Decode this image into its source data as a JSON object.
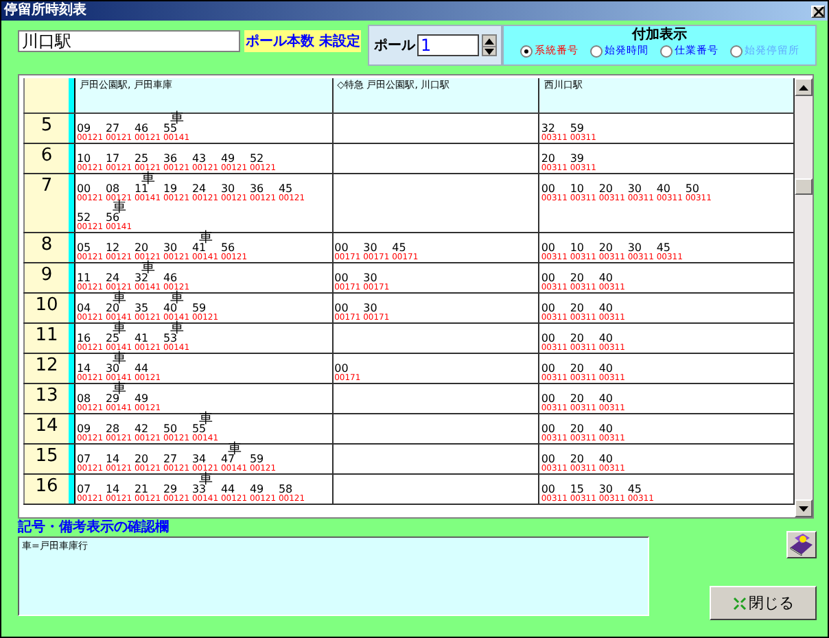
{
  "window": {
    "title": "停留所時刻表"
  },
  "stop_name": "川口駅",
  "pole_count_label": "ポール本数 未設定",
  "pole": {
    "label": "ポール",
    "value": "1"
  },
  "extra_display": {
    "title": "付加表示",
    "options": [
      {
        "label": "系統番号",
        "selected": true,
        "disabled": false
      },
      {
        "label": "始発時間",
        "selected": false,
        "disabled": false
      },
      {
        "label": "仕業番号",
        "selected": false,
        "disabled": false
      },
      {
        "label": "始発停留所",
        "selected": false,
        "disabled": true
      }
    ]
  },
  "timetable": {
    "columns": [
      "戸田公園駅, 戸田車庫",
      "◇特急 戸田公園駅, 川口駅",
      "西川口駅"
    ],
    "rows": [
      {
        "hour": "5",
        "cells": [
          [
            {
              "min": "09",
              "code": "00121"
            },
            {
              "min": "27",
              "code": "00121"
            },
            {
              "min": "46",
              "code": "00121"
            },
            {
              "min": "55",
              "code": "00141",
              "mark": "車"
            }
          ],
          [],
          [
            {
              "min": "32",
              "code": "00311"
            },
            {
              "min": "59",
              "code": "00311"
            }
          ]
        ]
      },
      {
        "hour": "6",
        "cells": [
          [
            {
              "min": "10",
              "code": "00121"
            },
            {
              "min": "17",
              "code": "00121"
            },
            {
              "min": "25",
              "code": "00121"
            },
            {
              "min": "36",
              "code": "00121"
            },
            {
              "min": "43",
              "code": "00121"
            },
            {
              "min": "49",
              "code": "00121"
            },
            {
              "min": "52",
              "code": "00121"
            }
          ],
          [],
          [
            {
              "min": "20",
              "code": "00311"
            },
            {
              "min": "39",
              "code": "00311"
            }
          ]
        ]
      },
      {
        "hour": "7",
        "cells": [
          [
            {
              "min": "00",
              "code": "00121"
            },
            {
              "min": "08",
              "code": "00121"
            },
            {
              "min": "11",
              "code": "00141",
              "mark": "車"
            },
            {
              "min": "19",
              "code": "00121"
            },
            {
              "min": "24",
              "code": "00121"
            },
            {
              "min": "30",
              "code": "00121"
            },
            {
              "min": "36",
              "code": "00121"
            },
            {
              "min": "45",
              "code": "00121"
            },
            {
              "min": "52",
              "code": "00121"
            },
            {
              "min": "56",
              "code": "00141",
              "mark": "車"
            }
          ],
          [],
          [
            {
              "min": "00",
              "code": "00311"
            },
            {
              "min": "10",
              "code": "00311"
            },
            {
              "min": "20",
              "code": "00311"
            },
            {
              "min": "30",
              "code": "00311"
            },
            {
              "min": "40",
              "code": "00311"
            },
            {
              "min": "50",
              "code": "00311"
            }
          ]
        ]
      },
      {
        "hour": "8",
        "cells": [
          [
            {
              "min": "05",
              "code": "00121"
            },
            {
              "min": "12",
              "code": "00121"
            },
            {
              "min": "20",
              "code": "00121"
            },
            {
              "min": "30",
              "code": "00121"
            },
            {
              "min": "41",
              "code": "00141",
              "mark": "車"
            },
            {
              "min": "56",
              "code": "00121"
            }
          ],
          [
            {
              "min": "00",
              "code": "00171"
            },
            {
              "min": "30",
              "code": "00171"
            },
            {
              "min": "45",
              "code": "00171"
            }
          ],
          [
            {
              "min": "00",
              "code": "00311"
            },
            {
              "min": "10",
              "code": "00311"
            },
            {
              "min": "20",
              "code": "00311"
            },
            {
              "min": "30",
              "code": "00311"
            },
            {
              "min": "45",
              "code": "00311"
            }
          ]
        ]
      },
      {
        "hour": "9",
        "cells": [
          [
            {
              "min": "11",
              "code": "00121"
            },
            {
              "min": "24",
              "code": "00121"
            },
            {
              "min": "32",
              "code": "00141",
              "mark": "車"
            },
            {
              "min": "46",
              "code": "00121"
            }
          ],
          [
            {
              "min": "00",
              "code": "00171"
            },
            {
              "min": "30",
              "code": "00171"
            }
          ],
          [
            {
              "min": "00",
              "code": "00311"
            },
            {
              "min": "20",
              "code": "00311"
            },
            {
              "min": "40",
              "code": "00311"
            }
          ]
        ]
      },
      {
        "hour": "10",
        "cells": [
          [
            {
              "min": "04",
              "code": "00121"
            },
            {
              "min": "20",
              "code": "00141",
              "mark": "車"
            },
            {
              "min": "35",
              "code": "00121"
            },
            {
              "min": "40",
              "code": "00141",
              "mark": "車"
            },
            {
              "min": "59",
              "code": "00121"
            }
          ],
          [
            {
              "min": "00",
              "code": "00171"
            },
            {
              "min": "30",
              "code": "00171"
            }
          ],
          [
            {
              "min": "00",
              "code": "00311"
            },
            {
              "min": "20",
              "code": "00311"
            },
            {
              "min": "40",
              "code": "00311"
            }
          ]
        ]
      },
      {
        "hour": "11",
        "cells": [
          [
            {
              "min": "16",
              "code": "00121"
            },
            {
              "min": "25",
              "code": "00141",
              "mark": "車"
            },
            {
              "min": "41",
              "code": "00121"
            },
            {
              "min": "53",
              "code": "00141",
              "mark": "車"
            }
          ],
          [],
          [
            {
              "min": "00",
              "code": "00311"
            },
            {
              "min": "20",
              "code": "00311"
            },
            {
              "min": "40",
              "code": "00311"
            }
          ]
        ]
      },
      {
        "hour": "12",
        "cells": [
          [
            {
              "min": "14",
              "code": "00121"
            },
            {
              "min": "30",
              "code": "00141",
              "mark": "車"
            },
            {
              "min": "44",
              "code": "00121"
            }
          ],
          [
            {
              "min": "00",
              "code": "00171"
            }
          ],
          [
            {
              "min": "00",
              "code": "00311"
            },
            {
              "min": "20",
              "code": "00311"
            },
            {
              "min": "40",
              "code": "00311"
            }
          ]
        ]
      },
      {
        "hour": "13",
        "cells": [
          [
            {
              "min": "08",
              "code": "00121"
            },
            {
              "min": "29",
              "code": "00141",
              "mark": "車"
            },
            {
              "min": "49",
              "code": "00121"
            }
          ],
          [],
          [
            {
              "min": "00",
              "code": "00311"
            },
            {
              "min": "20",
              "code": "00311"
            },
            {
              "min": "40",
              "code": "00311"
            }
          ]
        ]
      },
      {
        "hour": "14",
        "cells": [
          [
            {
              "min": "09",
              "code": "00121"
            },
            {
              "min": "28",
              "code": "00121"
            },
            {
              "min": "42",
              "code": "00121"
            },
            {
              "min": "50",
              "code": "00121"
            },
            {
              "min": "55",
              "code": "00141",
              "mark": "車"
            }
          ],
          [],
          [
            {
              "min": "00",
              "code": "00311"
            },
            {
              "min": "20",
              "code": "00311"
            },
            {
              "min": "40",
              "code": "00311"
            }
          ]
        ]
      },
      {
        "hour": "15",
        "cells": [
          [
            {
              "min": "07",
              "code": "00121"
            },
            {
              "min": "14",
              "code": "00121"
            },
            {
              "min": "20",
              "code": "00121"
            },
            {
              "min": "27",
              "code": "00121"
            },
            {
              "min": "34",
              "code": "00121"
            },
            {
              "min": "47",
              "code": "00141",
              "mark": "車"
            },
            {
              "min": "59",
              "code": "00121"
            }
          ],
          [],
          [
            {
              "min": "00",
              "code": "00311"
            },
            {
              "min": "20",
              "code": "00311"
            },
            {
              "min": "40",
              "code": "00311"
            }
          ]
        ]
      },
      {
        "hour": "16",
        "cells": [
          [
            {
              "min": "07",
              "code": "00121"
            },
            {
              "min": "14",
              "code": "00121"
            },
            {
              "min": "21",
              "code": "00121"
            },
            {
              "min": "29",
              "code": "00121"
            },
            {
              "min": "33",
              "code": "00141",
              "mark": "車"
            },
            {
              "min": "44",
              "code": "00121"
            },
            {
              "min": "49",
              "code": "00121"
            },
            {
              "min": "58",
              "code": "00121"
            }
          ],
          [],
          [
            {
              "min": "00",
              "code": "00311"
            },
            {
              "min": "15",
              "code": "00311"
            },
            {
              "min": "30",
              "code": "00311"
            },
            {
              "min": "45",
              "code": "00311"
            }
          ]
        ]
      }
    ]
  },
  "notes": {
    "label": "記号・備考表示の確認欄",
    "text": "車=戸田車庫行"
  },
  "close_button": "閉じる"
}
